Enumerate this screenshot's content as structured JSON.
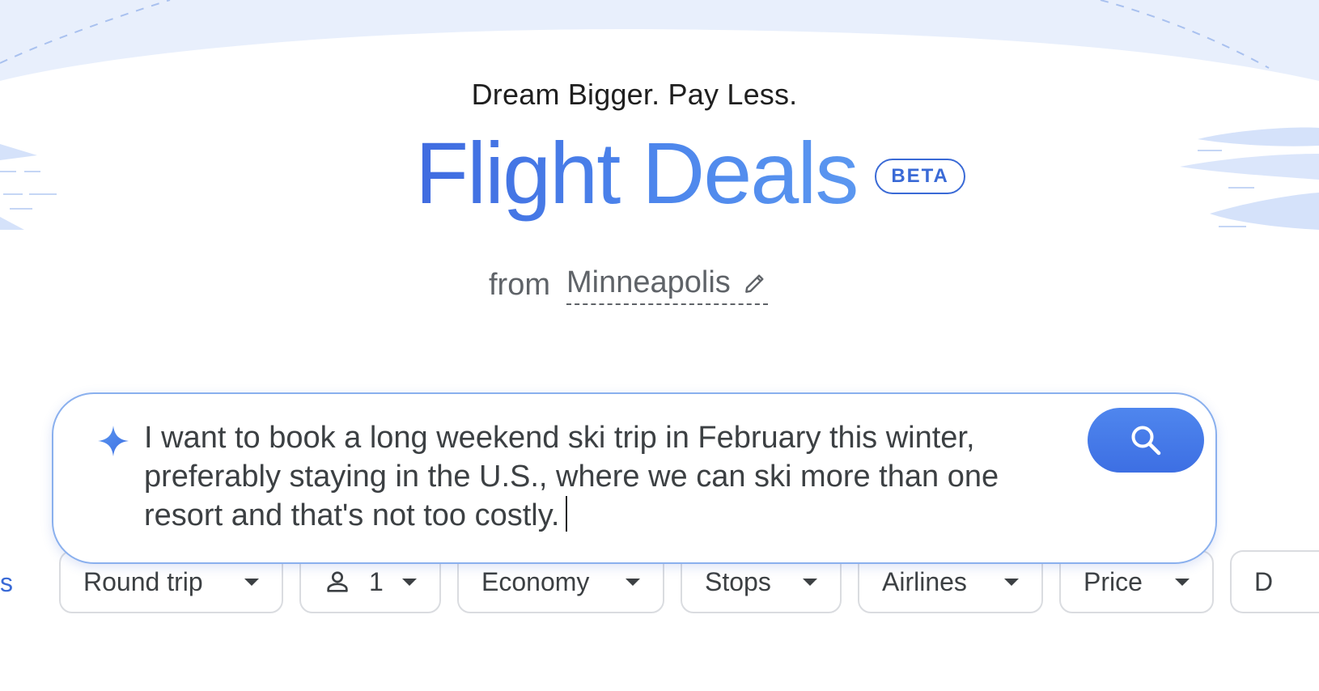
{
  "header": {
    "tagline": "Dream Bigger. Pay Less.",
    "title": "Flight Deals",
    "badge": "BETA"
  },
  "origin": {
    "prefix": "from",
    "city": "Minneapolis"
  },
  "search": {
    "query": "I want to book a long weekend ski trip in February this winter, preferably staying in the U.S., where we can ski more than one resort and that's not too costly."
  },
  "filters": {
    "clipped_left": "s",
    "trip_type": "Round trip",
    "passengers": "1",
    "cabin": "Economy",
    "stops": "Stops",
    "airlines": "Airlines",
    "price": "Price",
    "clipped_right": "D"
  },
  "colors": {
    "accent": "#3a6ad6",
    "title_gradient_start": "#3f6be0",
    "title_gradient_end": "#5b97f0",
    "decor_blue": "#e8effc"
  }
}
